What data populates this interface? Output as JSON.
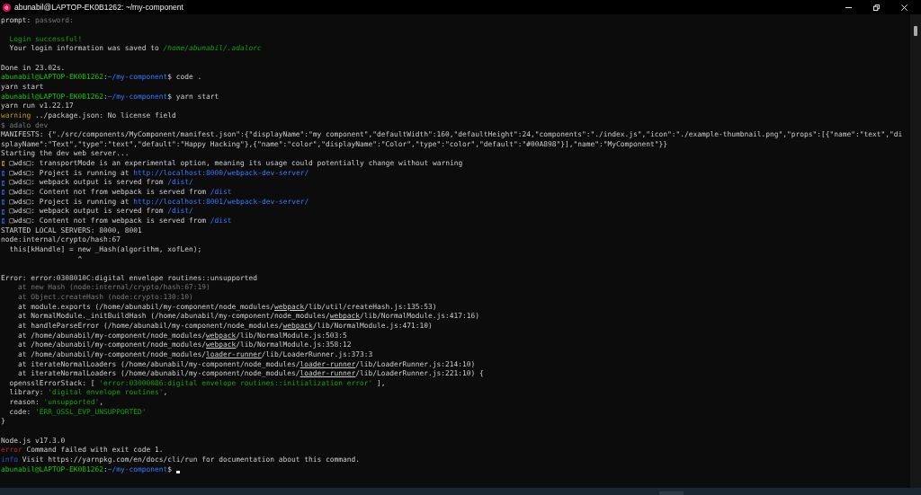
{
  "window": {
    "title": "abunabil@LAPTOP-EK0B1262: ~/my-component"
  },
  "terminal": {
    "lines": [
      {
        "kind": "text",
        "segments": [
          {
            "kind": "plain",
            "text": "prompt: "
          },
          {
            "kind": "grey",
            "text": "password:"
          }
        ]
      },
      {
        "kind": "blank"
      },
      {
        "kind": "text",
        "segments": [
          {
            "kind": "green",
            "text": "  Login successful!"
          }
        ]
      },
      {
        "kind": "text",
        "segments": [
          {
            "kind": "plain",
            "text": "  Your login information was saved to "
          },
          {
            "kind": "green-italic",
            "text": "/home/abunabil/.adalorc"
          }
        ]
      },
      {
        "kind": "blank"
      },
      {
        "kind": "text",
        "segments": [
          {
            "kind": "plain",
            "text": "Done in 23.02s."
          }
        ]
      },
      {
        "kind": "text",
        "segments": [
          {
            "kind": "user",
            "text": "abunabil@LAPTOP-EK0B1262"
          },
          {
            "kind": "plain",
            "text": ":"
          },
          {
            "kind": "path",
            "text": "~/my-component"
          },
          {
            "kind": "plain",
            "text": "$ code ."
          }
        ]
      },
      {
        "kind": "text",
        "segments": [
          {
            "kind": "plain",
            "text": "yarn start"
          }
        ]
      },
      {
        "kind": "text",
        "segments": [
          {
            "kind": "user",
            "text": "abunabil@LAPTOP-EK0B1262"
          },
          {
            "kind": "plain",
            "text": ":"
          },
          {
            "kind": "path",
            "text": "~/my-component"
          },
          {
            "kind": "plain",
            "text": "$ yarn start"
          }
        ]
      },
      {
        "kind": "text",
        "segments": [
          {
            "kind": "plain",
            "text": "yarn run v1.22.17"
          }
        ]
      },
      {
        "kind": "text",
        "segments": [
          {
            "kind": "yellow",
            "text": "warning"
          },
          {
            "kind": "plain",
            "text": " ../package.json: No license field"
          }
        ]
      },
      {
        "kind": "text",
        "segments": [
          {
            "kind": "grey",
            "text": "$ adalo dev"
          }
        ]
      },
      {
        "kind": "text",
        "segments": [
          {
            "kind": "plain",
            "text": "MANIFESTS: {\"./src/components/MyComponent/manifest.json\":{\"displayName\":\"my component\",\"defaultWidth\":160,\"defaultHeight\":24,\"components\":\"./index.js\",\"icon\":\"./example-thumbnail.png\",\"props\":[{\"name\":\"text\",\"di"
          }
        ]
      },
      {
        "kind": "text",
        "segments": [
          {
            "kind": "plain",
            "text": "splayName\":\"Text\",\"type\":\"text\",\"default\":\"Happy Hacking\"},{\"name\":\"color\",\"displayName\":\"Color\",\"type\":\"color\",\"default\":\"#00A898\"}],\"name\":\"MyComponent\"}}"
          }
        ]
      },
      {
        "kind": "text",
        "segments": [
          {
            "kind": "plain",
            "text": "Starting the dev web server..."
          }
        ]
      },
      {
        "kind": "warning",
        "segments": [
          {
            "kind": "plain",
            "text": "□wds□: transportMode is an experimental option, meaning its usage could potentially change without warning"
          }
        ]
      },
      {
        "kind": "info",
        "segments": [
          {
            "kind": "plain",
            "text": "□wds□: Project is running at "
          },
          {
            "kind": "blue",
            "text": "http://localhost:8000/webpack-dev-server/"
          }
        ]
      },
      {
        "kind": "info",
        "segments": [
          {
            "kind": "plain",
            "text": "□wds□: webpack output is served from "
          },
          {
            "kind": "blue",
            "text": "/dist/"
          }
        ]
      },
      {
        "kind": "info",
        "segments": [
          {
            "kind": "plain",
            "text": "□wds□: Content not from webpack is served from "
          },
          {
            "kind": "blue",
            "text": "/dist"
          }
        ]
      },
      {
        "kind": "info",
        "segments": [
          {
            "kind": "plain",
            "text": "□wds□: Project is running at "
          },
          {
            "kind": "blue",
            "text": "http://localhost:8001/webpack-dev-server/"
          }
        ]
      },
      {
        "kind": "info",
        "segments": [
          {
            "kind": "plain",
            "text": "□wds□: webpack output is served from "
          },
          {
            "kind": "blue",
            "text": "/dist/"
          }
        ]
      },
      {
        "kind": "info",
        "segments": [
          {
            "kind": "plain",
            "text": "□wds□: Content not from webpack is served from "
          },
          {
            "kind": "blue",
            "text": "/dist"
          }
        ]
      },
      {
        "kind": "text",
        "segments": [
          {
            "kind": "plain",
            "text": "STARTED LOCAL SERVERS: 8000, 8001"
          }
        ]
      },
      {
        "kind": "text",
        "segments": [
          {
            "kind": "plain",
            "text": "node:internal/crypto/hash:67"
          }
        ]
      },
      {
        "kind": "text",
        "segments": [
          {
            "kind": "plain",
            "text": "  this[kHandle] = new _Hash(algorithm, xofLen);"
          }
        ]
      },
      {
        "kind": "text",
        "segments": [
          {
            "kind": "plain",
            "text": "                  ^"
          }
        ]
      },
      {
        "kind": "blank"
      },
      {
        "kind": "text",
        "segments": [
          {
            "kind": "plain",
            "text": "Error: error:0308010C:digital envelope routines::unsupported"
          }
        ]
      },
      {
        "kind": "text",
        "segments": [
          {
            "kind": "grey",
            "text": "    at new Hash (node:internal/crypto/hash:67:19)"
          }
        ]
      },
      {
        "kind": "text",
        "segments": [
          {
            "kind": "grey",
            "text": "    at Object.createHash (node:crypto:130:10)"
          }
        ]
      },
      {
        "kind": "text",
        "segments": [
          {
            "kind": "plain",
            "text": "    at module.exports (/home/abunabil/my-component/node_modules/"
          },
          {
            "kind": "underline",
            "text": "webpack"
          },
          {
            "kind": "plain",
            "text": "/lib/util/createHash.js:135:53)"
          }
        ]
      },
      {
        "kind": "text",
        "segments": [
          {
            "kind": "plain",
            "text": "    at NormalModule._initBuildHash (/home/abunabil/my-component/node_modules/"
          },
          {
            "kind": "underline",
            "text": "webpack"
          },
          {
            "kind": "plain",
            "text": "/lib/NormalModule.js:417:16)"
          }
        ]
      },
      {
        "kind": "text",
        "segments": [
          {
            "kind": "plain",
            "text": "    at handleParseError (/home/abunabil/my-component/node_modules/"
          },
          {
            "kind": "underline",
            "text": "webpack"
          },
          {
            "kind": "plain",
            "text": "/lib/NormalModule.js:471:10)"
          }
        ]
      },
      {
        "kind": "text",
        "segments": [
          {
            "kind": "plain",
            "text": "    at /home/abunabil/my-component/node_modules/"
          },
          {
            "kind": "underline",
            "text": "webpack"
          },
          {
            "kind": "plain",
            "text": "/lib/NormalModule.js:503:5"
          }
        ]
      },
      {
        "kind": "text",
        "segments": [
          {
            "kind": "plain",
            "text": "    at /home/abunabil/my-component/node_modules/"
          },
          {
            "kind": "underline",
            "text": "webpack"
          },
          {
            "kind": "plain",
            "text": "/lib/NormalModule.js:358:12"
          }
        ]
      },
      {
        "kind": "text",
        "segments": [
          {
            "kind": "plain",
            "text": "    at /home/abunabil/my-component/node_modules/"
          },
          {
            "kind": "underline",
            "text": "loader-runner"
          },
          {
            "kind": "plain",
            "text": "/lib/LoaderRunner.js:373:3"
          }
        ]
      },
      {
        "kind": "text",
        "segments": [
          {
            "kind": "plain",
            "text": "    at iterateNormalLoaders (/home/abunabil/my-component/node_modules/"
          },
          {
            "kind": "underline",
            "text": "loader-runner"
          },
          {
            "kind": "plain",
            "text": "/lib/LoaderRunner.js:214:10)"
          }
        ]
      },
      {
        "kind": "text",
        "segments": [
          {
            "kind": "plain",
            "text": "    at iterateNormalLoaders (/home/abunabil/my-component/node_modules/"
          },
          {
            "kind": "underline",
            "text": "loader-runner"
          },
          {
            "kind": "plain",
            "text": "/lib/LoaderRunner.js:221:10) {"
          }
        ]
      },
      {
        "kind": "text",
        "segments": [
          {
            "kind": "plain",
            "text": "  opensslErrorStack: [ "
          },
          {
            "kind": "green",
            "text": "'error:03000086:digital envelope routines::initialization error'"
          },
          {
            "kind": "plain",
            "text": " ],"
          }
        ]
      },
      {
        "kind": "text",
        "segments": [
          {
            "kind": "plain",
            "text": "  library: "
          },
          {
            "kind": "green",
            "text": "'digital envelope routines'"
          },
          {
            "kind": "plain",
            "text": ","
          }
        ]
      },
      {
        "kind": "text",
        "segments": [
          {
            "kind": "plain",
            "text": "  reason: "
          },
          {
            "kind": "green",
            "text": "'unsupported'"
          },
          {
            "kind": "plain",
            "text": ","
          }
        ]
      },
      {
        "kind": "text",
        "segments": [
          {
            "kind": "plain",
            "text": "  code: "
          },
          {
            "kind": "green",
            "text": "'ERR_OSSL_EVP_UNSUPPORTED'"
          }
        ]
      },
      {
        "kind": "text",
        "segments": [
          {
            "kind": "plain",
            "text": "}"
          }
        ]
      },
      {
        "kind": "blank"
      },
      {
        "kind": "text",
        "segments": [
          {
            "kind": "plain",
            "text": "Node.js v17.3.0"
          }
        ]
      },
      {
        "kind": "text",
        "segments": [
          {
            "kind": "red",
            "text": "error"
          },
          {
            "kind": "plain",
            "text": " Command failed with exit code 1."
          }
        ]
      },
      {
        "kind": "text",
        "segments": [
          {
            "kind": "darkblue",
            "text": "info"
          },
          {
            "kind": "plain",
            "text": " Visit https://yarnpkg.com/en/docs/cli/run for documentation about this command."
          }
        ]
      },
      {
        "kind": "active",
        "segments": [
          {
            "kind": "user",
            "text": "abunabil@LAPTOP-EK0B1262"
          },
          {
            "kind": "plain",
            "text": ":"
          },
          {
            "kind": "path",
            "text": "~/my-component"
          },
          {
            "kind": "plain",
            "text": "$"
          }
        ]
      }
    ]
  }
}
